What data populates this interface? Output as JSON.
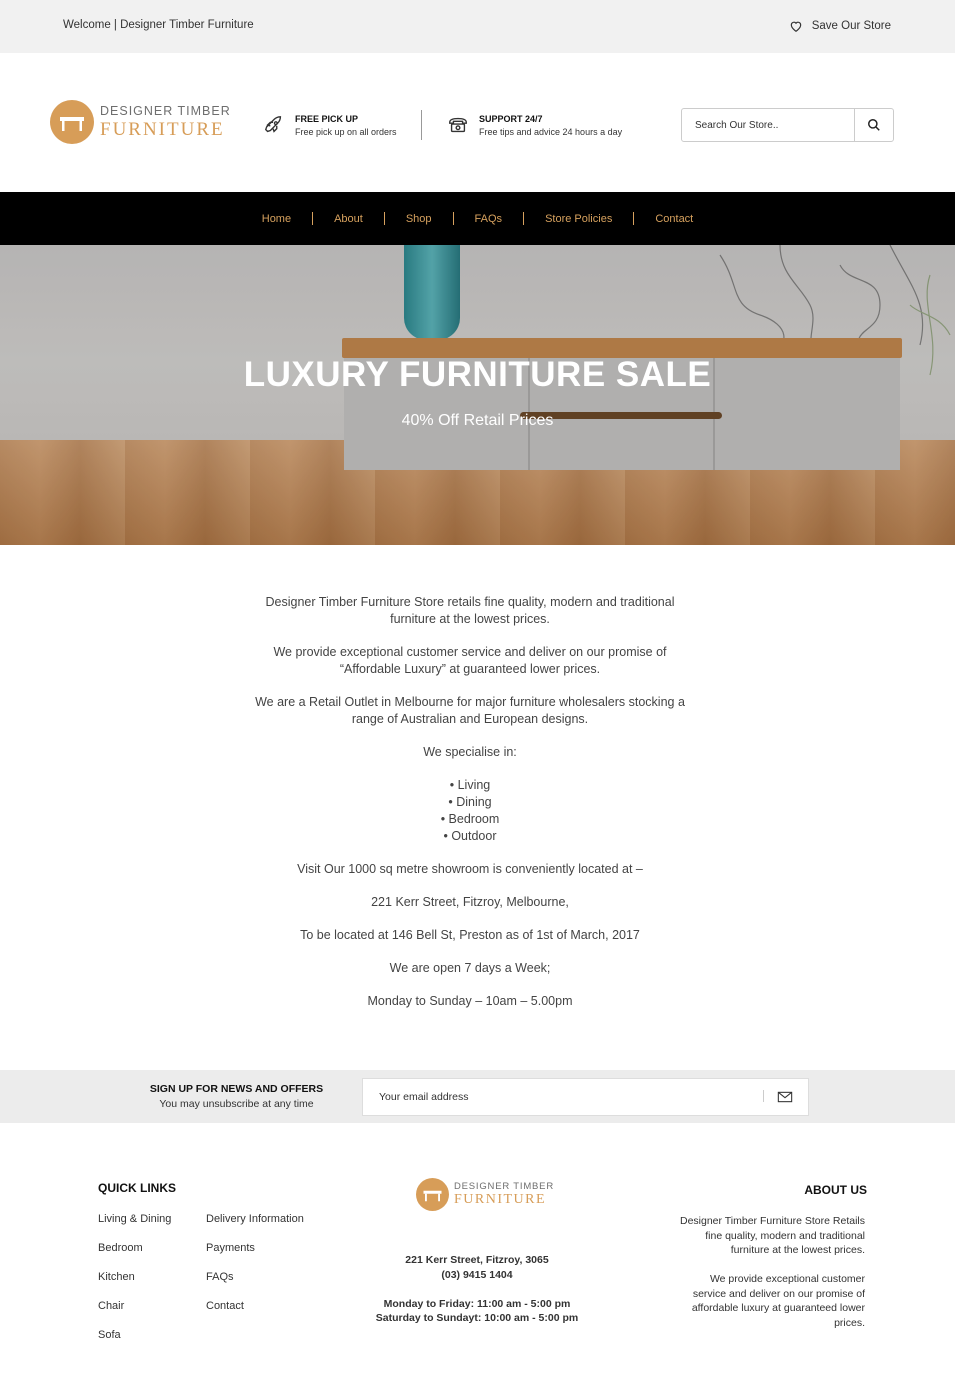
{
  "topbar": {
    "welcome": "Welcome | Designer Timber Furniture",
    "save_store": "Save Our Store"
  },
  "logo": {
    "line1": "DESIGNER TIMBER",
    "line2": "FURNITURE"
  },
  "features": [
    {
      "title": "FREE PICK UP",
      "desc": "Free pick up on all orders",
      "icon": "rocket-icon"
    },
    {
      "title": "SUPPORT 24/7",
      "desc": "Free tips and advice 24 hours a day",
      "icon": "phone-icon"
    }
  ],
  "search": {
    "placeholder": "Search Our Store.."
  },
  "nav": [
    "Home",
    "About",
    "Shop",
    "FAQs",
    "Store Policies",
    "Contact"
  ],
  "hero": {
    "title": "LUXURY FURNITURE SALE",
    "subtitle": "40% Off Retail Prices"
  },
  "about": {
    "p1": "Designer Timber Furniture Store  retails fine quality, modern and traditional furniture at the lowest prices.",
    "p2": "We provide exceptional customer service and deliver on our promise of “Affordable Luxury” at guaranteed lower prices.",
    "p3": "We are a Retail Outlet in Melbourne for major furniture wholesalers stocking a range of Australian and European designs.",
    "p4": "We specialise in:",
    "list": [
      "• Living",
      "• Dining",
      "• Bedroom",
      "• Outdoor"
    ],
    "p5": "Visit Our 1000 sq metre showroom is conveniently located at –",
    "p6": "221 Kerr Street, Fitzroy, Melbourne,",
    "p7": "To be located at 146 Bell St, Preston as of 1st of March, 2017",
    "p8": "We are open 7 days a Week;",
    "p9": "Monday to Sunday – 10am – 5.00pm"
  },
  "newsletter": {
    "title": "SIGN UP FOR NEWS AND OFFERS",
    "subtitle": "You may unsubscribe at any time",
    "placeholder": "Your email address"
  },
  "footer": {
    "quick_links_title": "QUICK LINKS",
    "quick_links_col1": [
      "Living & Dining",
      "Bedroom",
      "Kitchen",
      "Chair",
      "Sofa"
    ],
    "quick_links_col2": [
      "Delivery Information",
      "Payments",
      "FAQs",
      "Contact"
    ],
    "address": "221 Kerr Street, Fitzroy, 3065",
    "phone": "(03) 9415 1404",
    "hours_weekday": "Monday to Friday: 11:00 am - 5:00 pm",
    "hours_weekend": "Saturday to Sundayt: 10:00 am - 5:00 pm",
    "about_title": "ABOUT US",
    "about_p1": "Designer Timber Furniture Store Retails fine quality, modern and traditional furniture at the lowest prices.",
    "about_p2": "We provide exceptional customer service and deliver on our promise of affordable luxury at guaranteed lower prices."
  },
  "colors": {
    "accent": "#d6a15e",
    "nav_bg": "#000000",
    "topbar_bg": "#f1f1f1"
  }
}
